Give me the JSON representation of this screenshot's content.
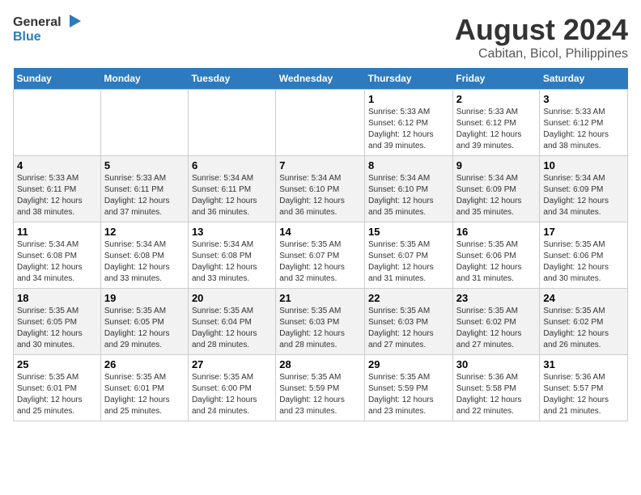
{
  "header": {
    "logo_general": "General",
    "logo_blue": "Blue",
    "title": "August 2024",
    "subtitle": "Cabitan, Bicol, Philippines"
  },
  "weekdays": [
    "Sunday",
    "Monday",
    "Tuesday",
    "Wednesday",
    "Thursday",
    "Friday",
    "Saturday"
  ],
  "weeks": [
    [
      {
        "day": "",
        "info": ""
      },
      {
        "day": "",
        "info": ""
      },
      {
        "day": "",
        "info": ""
      },
      {
        "day": "",
        "info": ""
      },
      {
        "day": "1",
        "info": "Sunrise: 5:33 AM\nSunset: 6:12 PM\nDaylight: 12 hours\nand 39 minutes."
      },
      {
        "day": "2",
        "info": "Sunrise: 5:33 AM\nSunset: 6:12 PM\nDaylight: 12 hours\nand 39 minutes."
      },
      {
        "day": "3",
        "info": "Sunrise: 5:33 AM\nSunset: 6:12 PM\nDaylight: 12 hours\nand 38 minutes."
      }
    ],
    [
      {
        "day": "4",
        "info": "Sunrise: 5:33 AM\nSunset: 6:11 PM\nDaylight: 12 hours\nand 38 minutes."
      },
      {
        "day": "5",
        "info": "Sunrise: 5:33 AM\nSunset: 6:11 PM\nDaylight: 12 hours\nand 37 minutes."
      },
      {
        "day": "6",
        "info": "Sunrise: 5:34 AM\nSunset: 6:11 PM\nDaylight: 12 hours\nand 36 minutes."
      },
      {
        "day": "7",
        "info": "Sunrise: 5:34 AM\nSunset: 6:10 PM\nDaylight: 12 hours\nand 36 minutes."
      },
      {
        "day": "8",
        "info": "Sunrise: 5:34 AM\nSunset: 6:10 PM\nDaylight: 12 hours\nand 35 minutes."
      },
      {
        "day": "9",
        "info": "Sunrise: 5:34 AM\nSunset: 6:09 PM\nDaylight: 12 hours\nand 35 minutes."
      },
      {
        "day": "10",
        "info": "Sunrise: 5:34 AM\nSunset: 6:09 PM\nDaylight: 12 hours\nand 34 minutes."
      }
    ],
    [
      {
        "day": "11",
        "info": "Sunrise: 5:34 AM\nSunset: 6:08 PM\nDaylight: 12 hours\nand 34 minutes."
      },
      {
        "day": "12",
        "info": "Sunrise: 5:34 AM\nSunset: 6:08 PM\nDaylight: 12 hours\nand 33 minutes."
      },
      {
        "day": "13",
        "info": "Sunrise: 5:34 AM\nSunset: 6:08 PM\nDaylight: 12 hours\nand 33 minutes."
      },
      {
        "day": "14",
        "info": "Sunrise: 5:35 AM\nSunset: 6:07 PM\nDaylight: 12 hours\nand 32 minutes."
      },
      {
        "day": "15",
        "info": "Sunrise: 5:35 AM\nSunset: 6:07 PM\nDaylight: 12 hours\nand 31 minutes."
      },
      {
        "day": "16",
        "info": "Sunrise: 5:35 AM\nSunset: 6:06 PM\nDaylight: 12 hours\nand 31 minutes."
      },
      {
        "day": "17",
        "info": "Sunrise: 5:35 AM\nSunset: 6:06 PM\nDaylight: 12 hours\nand 30 minutes."
      }
    ],
    [
      {
        "day": "18",
        "info": "Sunrise: 5:35 AM\nSunset: 6:05 PM\nDaylight: 12 hours\nand 30 minutes."
      },
      {
        "day": "19",
        "info": "Sunrise: 5:35 AM\nSunset: 6:05 PM\nDaylight: 12 hours\nand 29 minutes."
      },
      {
        "day": "20",
        "info": "Sunrise: 5:35 AM\nSunset: 6:04 PM\nDaylight: 12 hours\nand 28 minutes."
      },
      {
        "day": "21",
        "info": "Sunrise: 5:35 AM\nSunset: 6:03 PM\nDaylight: 12 hours\nand 28 minutes."
      },
      {
        "day": "22",
        "info": "Sunrise: 5:35 AM\nSunset: 6:03 PM\nDaylight: 12 hours\nand 27 minutes."
      },
      {
        "day": "23",
        "info": "Sunrise: 5:35 AM\nSunset: 6:02 PM\nDaylight: 12 hours\nand 27 minutes."
      },
      {
        "day": "24",
        "info": "Sunrise: 5:35 AM\nSunset: 6:02 PM\nDaylight: 12 hours\nand 26 minutes."
      }
    ],
    [
      {
        "day": "25",
        "info": "Sunrise: 5:35 AM\nSunset: 6:01 PM\nDaylight: 12 hours\nand 25 minutes."
      },
      {
        "day": "26",
        "info": "Sunrise: 5:35 AM\nSunset: 6:01 PM\nDaylight: 12 hours\nand 25 minutes."
      },
      {
        "day": "27",
        "info": "Sunrise: 5:35 AM\nSunset: 6:00 PM\nDaylight: 12 hours\nand 24 minutes."
      },
      {
        "day": "28",
        "info": "Sunrise: 5:35 AM\nSunset: 5:59 PM\nDaylight: 12 hours\nand 23 minutes."
      },
      {
        "day": "29",
        "info": "Sunrise: 5:35 AM\nSunset: 5:59 PM\nDaylight: 12 hours\nand 23 minutes."
      },
      {
        "day": "30",
        "info": "Sunrise: 5:36 AM\nSunset: 5:58 PM\nDaylight: 12 hours\nand 22 minutes."
      },
      {
        "day": "31",
        "info": "Sunrise: 5:36 AM\nSunset: 5:57 PM\nDaylight: 12 hours\nand 21 minutes."
      }
    ]
  ]
}
